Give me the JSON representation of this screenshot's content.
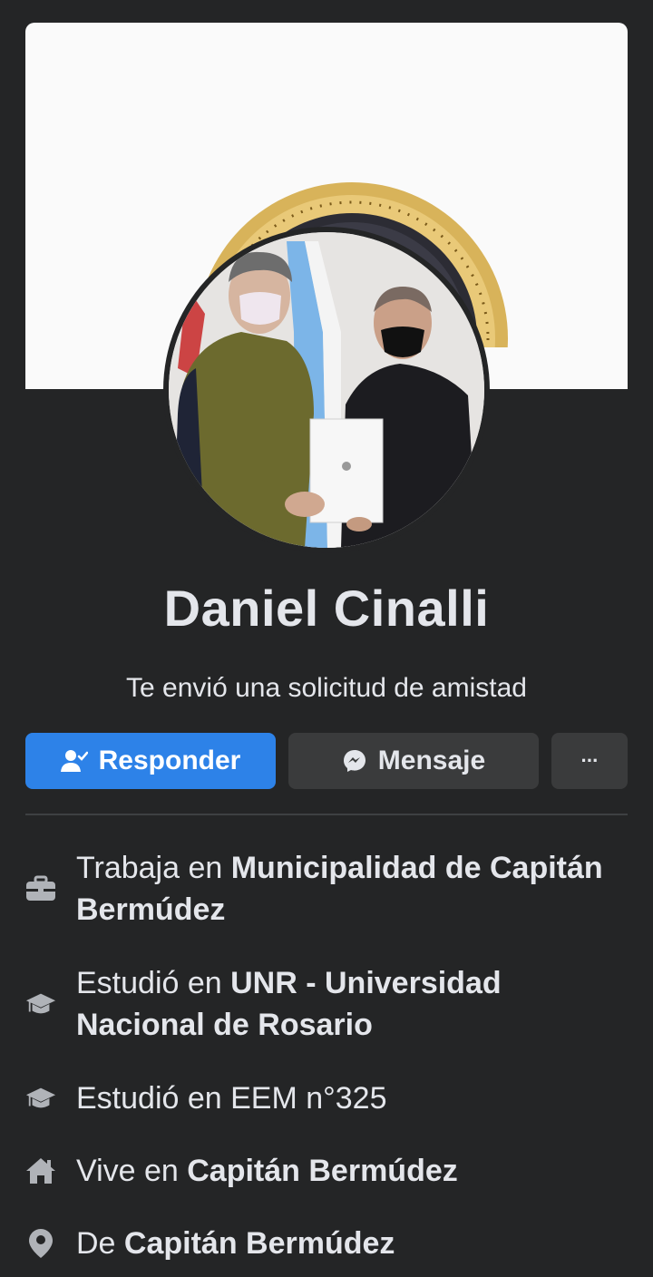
{
  "profile": {
    "name": "Daniel Cinalli",
    "subtitle": "Te envió una solicitud de amistad"
  },
  "actions": {
    "respond_label": "Responder",
    "message_label": "Mensaje",
    "more_label": "···"
  },
  "info": [
    {
      "icon": "briefcase-icon",
      "prefix": "Trabaja en ",
      "value": "Municipalidad de Capitán Bermúdez"
    },
    {
      "icon": "graduation-cap-icon",
      "prefix": "Estudió en ",
      "value": "UNR - Universidad Nacional de Rosario"
    },
    {
      "icon": "graduation-cap-icon",
      "prefix": "Estudió en EEM n°325",
      "value": ""
    },
    {
      "icon": "home-icon",
      "prefix": "Vive en ",
      "value": "Capitán Bermúdez"
    },
    {
      "icon": "location-pin-icon",
      "prefix": "De ",
      "value": "Capitán Bermúdez"
    }
  ],
  "colors": {
    "background": "#242526",
    "primary_button": "#2d82e8",
    "secondary_button": "#3a3b3c",
    "text": "#e4e6eb",
    "icon": "#b0b3b8"
  }
}
